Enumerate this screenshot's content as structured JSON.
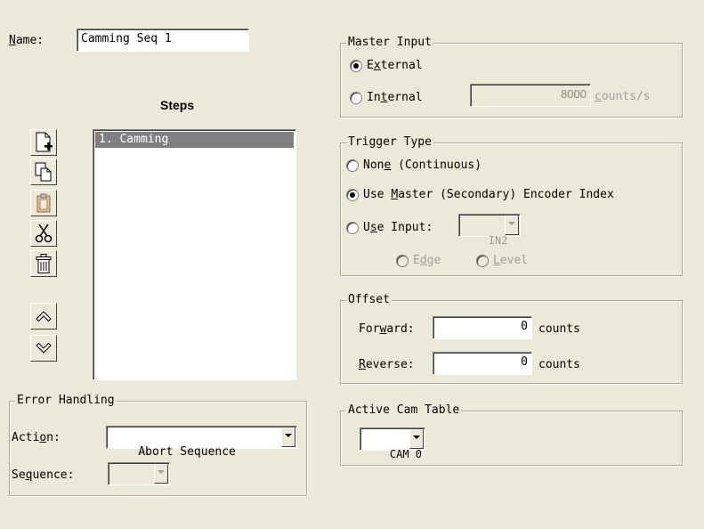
{
  "name_field": {
    "label_u": "N",
    "label_rest": "ame:",
    "value": "Camming Seq 1"
  },
  "steps": {
    "title": "Steps",
    "items": [
      "1. Camming"
    ],
    "toolbar": [
      "new-step",
      "copy",
      "paste",
      "cut",
      "delete",
      "move-up",
      "move-down"
    ]
  },
  "error_handling": {
    "title": "Error Handling",
    "action_label_pre": "Acti",
    "action_label_u": "o",
    "action_label_post": "n:",
    "action_value": "Abort Sequence",
    "sequence_label_pre": "Se",
    "sequence_label_u": "q",
    "sequence_label_post": "uence:",
    "sequence_value": ""
  },
  "master_input": {
    "title": "Master Input",
    "external_pre": "E",
    "external_u": "x",
    "external_post": "ternal",
    "internal_pre": "In",
    "internal_u": "t",
    "internal_post": "ernal",
    "internal_value": "8000",
    "unit_u": "c",
    "unit_rest": "ounts/s",
    "selected": "external"
  },
  "trigger_type": {
    "title": "Trigger Type",
    "none_pre": "Non",
    "none_u": "e",
    "none_post": " (Continuous)",
    "master_pre": "Use ",
    "master_u": "M",
    "master_post": "aster (Secondary) Encoder Index",
    "input_pre": "U",
    "input_u": "s",
    "input_post": "e Input:",
    "input_value": "IN2",
    "edge_pre": "E",
    "edge_u": "d",
    "edge_post": "ge",
    "level_pre": "",
    "level_u": "L",
    "level_post": "evel",
    "selected": "master"
  },
  "offset": {
    "title": "Offset",
    "forward_pre": "For",
    "forward_u": "w",
    "forward_post": "ard:",
    "forward_value": "0",
    "reverse_pre": "",
    "reverse_u": "R",
    "reverse_post": "everse:",
    "reverse_value": "0",
    "unit": "counts"
  },
  "active_cam": {
    "title": "Active Cam Table",
    "value": "CAM 0"
  },
  "colors": {
    "background": "#ece9d8",
    "selection": "#808080"
  }
}
